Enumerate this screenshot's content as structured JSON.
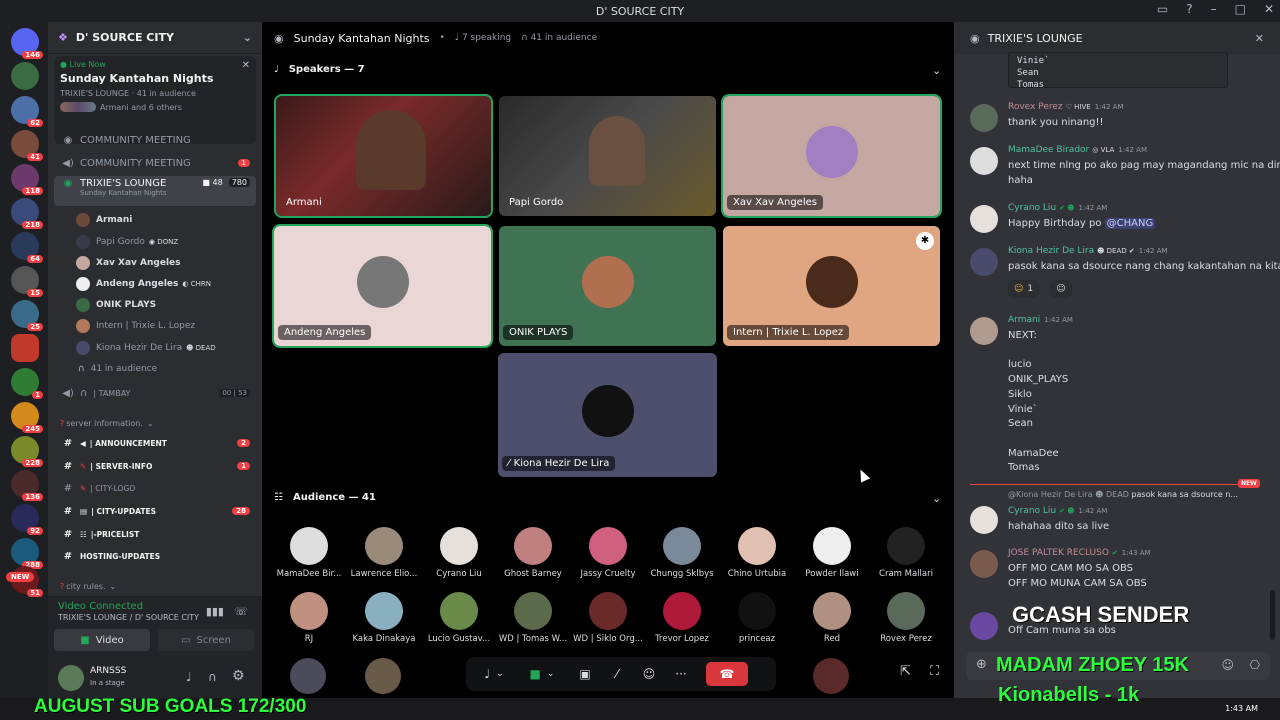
{
  "window": {
    "title": "D' SOURCE CITY"
  },
  "server_badges": [
    "146",
    "62",
    "41",
    "118",
    "218",
    "64",
    "15",
    "25",
    "1",
    "245",
    "228",
    "136",
    "92",
    "288",
    "51"
  ],
  "server_new": "NEW",
  "guild": {
    "name": "D' SOURCE CITY"
  },
  "event": {
    "live": "Live Now",
    "name": "Sunday Kantahan Nights",
    "channel": "TRIXIE'S LOUNGE",
    "audience": "41 in audience",
    "attendees": "Armani and 6 others"
  },
  "channels": [
    {
      "name": "COMMUNITY MEETING",
      "badge": ""
    },
    {
      "name": "COMMUNITY MEETING",
      "badge": "1"
    },
    {
      "name": "TRIXIE'S LOUNGE",
      "sub": "Sunday Kantahan Nights",
      "count1": "48",
      "count2": "780"
    }
  ],
  "stage_users": [
    {
      "name": "Armani",
      "tag": ""
    },
    {
      "name": "Papi Gordo",
      "tag": "DONZ"
    },
    {
      "name": "Xav Xav Angeles",
      "tag": ""
    },
    {
      "name": "Andeng Angeles",
      "tag": "CHRN"
    },
    {
      "name": "ONIK PLAYS",
      "tag": ""
    },
    {
      "name": "Intern | Trixie L. Lopez",
      "tag": ""
    },
    {
      "name": "Kiona Hezir De Lira",
      "tag": "DEAD"
    }
  ],
  "stage_audience": "41 in audience",
  "tambay": {
    "name": "| TAMBAY",
    "a": "00",
    "b": "53"
  },
  "category1": "server information.",
  "text_channels": [
    {
      "name": "| ANNOUNCEMENT",
      "badge": "2"
    },
    {
      "name": "| SERVER-INFO",
      "badge": "1"
    },
    {
      "name": "| CITY-LOGO",
      "badge": ""
    },
    {
      "name": "| CITY-UPDATES",
      "badge": "28"
    },
    {
      "name": "|-PRICELIST",
      "badge": ""
    },
    {
      "name": "HOSTING-UPDATES",
      "badge": ""
    }
  ],
  "category2": "city rules.",
  "voice": {
    "status": "Video Connected",
    "where": "TRIXIE'S LOUNGE / D' SOURCE CITY",
    "video": "Video",
    "screen": "Screen"
  },
  "user": {
    "name": "ARNSSS",
    "status": "In a stage"
  },
  "stage": {
    "title": "Sunday Kantahan Nights",
    "speaking": "7 speaking",
    "audience": "41 in audience"
  },
  "speakers_label": "Speakers — 7",
  "speakers": [
    "Armani",
    "Papi Gordo",
    "Xav Xav Angeles",
    "Andeng Angeles",
    "ONIK PLAYS",
    "Intern | Trixie L. Lopez",
    "Kiona Hezir De Lira"
  ],
  "audience_label": "Audience — 41",
  "audience": [
    "MamaDee Bir...",
    "Lawrence Elio...",
    "Cyrano Liu",
    "Ghost Barney",
    "Jassy Cruelty",
    "Chungg Sklbys",
    "Chino Urtubia",
    "Powder Ilawi",
    "Cram Mallari",
    "RJ",
    "Kaka Dinakaya",
    "Lucio Gustav...",
    "WD | Tomas W...",
    "WD | Siklo Org...",
    "Trevor Lopez",
    "princeaz",
    "Red",
    "Rovex Perez"
  ],
  "chat": {
    "title": "TRIXIE'S LOUNGE",
    "code_lines": "Vinie`\nSean\nTomas",
    "messages": [
      {
        "author": "Rovex Perez",
        "tag": "HIVE",
        "time": "1:42 AM",
        "text": "thank you ninang!!"
      },
      {
        "author": "MamaDee Birador",
        "tag": "VLA",
        "time": "1:42 AM",
        "text": "next time nlng po ako pag may magandang mic na din\nhaha"
      },
      {
        "author": "Cyrano Liu",
        "tag": "",
        "time": "1:42 AM",
        "text": "Happy Birthday po ",
        "mention": "@CHANG"
      },
      {
        "author": "Kiona Hezir De Lira",
        "tag": "DEAD",
        "time": "1:42 AM",
        "text": "pasok kana sa dsource nang chang kakantahan na kita",
        "reaction": "1"
      },
      {
        "author": "Armani",
        "tag": "",
        "time": "1:42 AM",
        "text": "NEXT:\n\nlucio\nONIK_PLAYS\nSiklo\nVinie`\nSean\n\nMamaDee\nTomas"
      },
      {
        "author": "Cyrano Liu",
        "tag": "",
        "time": "1:42 AM",
        "text": "hahahaa dito sa live",
        "reply": "@Kiona Hezir De Lira",
        "reply_tag": "DEAD",
        "reply_text": "pasok kana sa dsource n..."
      },
      {
        "author": "JOSE PALTEK RECLUSO",
        "tag": "",
        "time": "1:43 AM",
        "text": "OFF MO CAM MO SA OBS\nOFF MO MUNA CAM SA OBS"
      },
      {
        "author": "",
        "tag": "",
        "time": "",
        "text": "Off Cam muna sa obs"
      }
    ],
    "new_label": "NEW"
  },
  "overlay": {
    "gcash": "GCASH SENDER",
    "madam": "MADAM ZHOEY 15K",
    "kiona": "Kionabells - 1k",
    "goals": "AUGUST SUB GOALS 172/300"
  },
  "taskbar": {
    "time": "1:43 AM"
  },
  "colors": {
    "accent": "#23a55a",
    "danger": "#da373c",
    "sidebar": "#2b2d31",
    "chat": "#313338",
    "overlay_green": "#2bff3c"
  }
}
